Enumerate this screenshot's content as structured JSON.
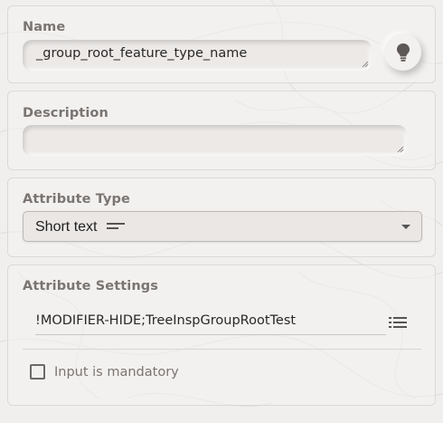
{
  "name_section": {
    "label": "Name",
    "value": "_group_root_feature_type_name"
  },
  "description_section": {
    "label": "Description",
    "value": ""
  },
  "attribute_type_section": {
    "label": "Attribute Type",
    "selected": "Short text",
    "selected_icon": "short-text-icon"
  },
  "attribute_settings_section": {
    "label": "Attribute Settings",
    "value": "!MODIFIER-HIDE;TreeInspGroupRootTest",
    "list_icon": "list-icon",
    "mandatory_label": "Input is mandatory",
    "mandatory_checked": false
  },
  "icons": {
    "hint": "lightbulb-icon",
    "dropdown": "caret-down-icon",
    "resize": "resize-grip-icon"
  },
  "colors": {
    "background": "#f1efee",
    "label": "#7a7572",
    "text": "#2a2827"
  }
}
